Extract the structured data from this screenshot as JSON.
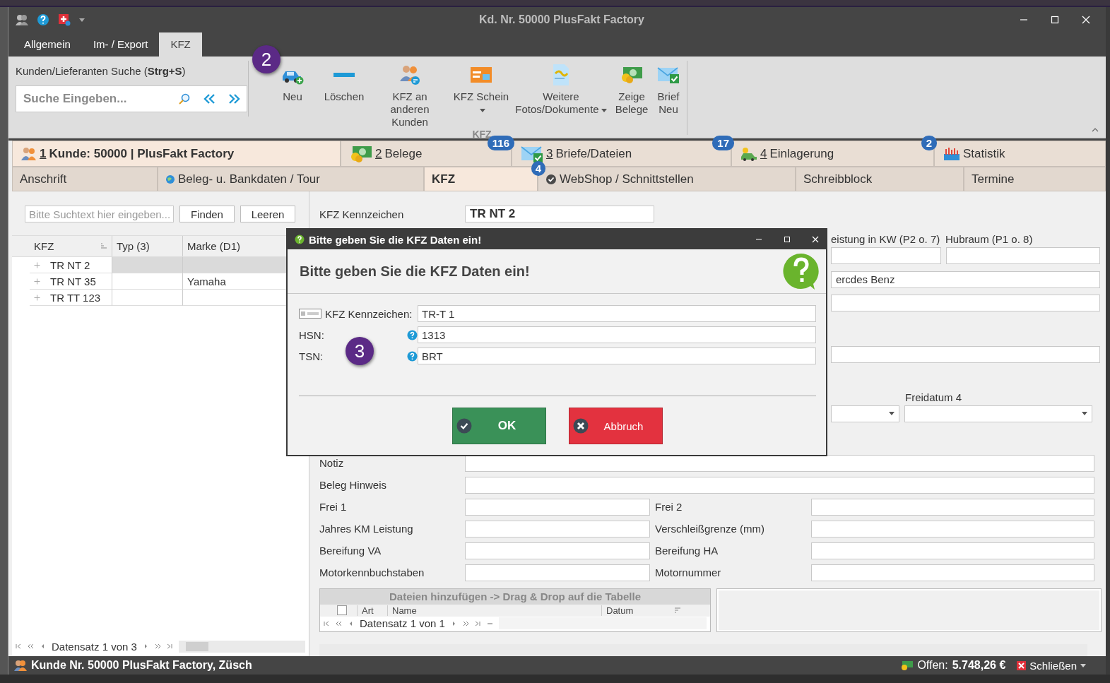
{
  "window": {
    "title": "Kd. Nr. 50000 PlusFakt Factory"
  },
  "ribbon": {
    "tabs": [
      {
        "label": "Allgemein",
        "selected": false
      },
      {
        "label": "Im- / Export",
        "selected": false
      },
      {
        "label": "KFZ",
        "selected": true
      }
    ],
    "search": {
      "label": "Kunden/Lieferanten Suche (**Strg+S**)",
      "placeholder": "Suche Eingeben..."
    },
    "step_marker": "2",
    "buttons": [
      {
        "label": "Neu",
        "kind": "car-add",
        "dropdown": false
      },
      {
        "label": "Löschen",
        "kind": "minus",
        "dropdown": false
      },
      {
        "label": "KFZ an anderen Kunden",
        "kind": "people-swap",
        "dropdown": false
      },
      {
        "label": "KFZ Schein",
        "kind": "card",
        "dropdown": true
      },
      {
        "label": "Weitere Fotos/Dokumente",
        "kind": "document",
        "dropdown": true
      },
      {
        "label": "Zeige Belege",
        "kind": "money",
        "dropdown": false
      },
      {
        "label": "Brief Neu",
        "kind": "mail",
        "dropdown": false
      }
    ],
    "group_label": "KFZ"
  },
  "main_tabs": [
    {
      "key": "1",
      "label": "Kunde: 50000 | PlusFakt Factory",
      "kind": "people",
      "selected": true
    },
    {
      "key": "2",
      "label": "Belege",
      "kind": "money",
      "badge": "116",
      "selected": false
    },
    {
      "key": "3",
      "label": "Briefe/Dateien",
      "kind": "mail",
      "badge": "17",
      "selected": false
    },
    {
      "key": "4",
      "label": "Einlagerung",
      "kind": "car",
      "badge": "2",
      "selected": false
    },
    {
      "label": "Statistik",
      "kind": "chart",
      "selected": false
    }
  ],
  "sub_tabs": [
    {
      "label": "Anschrift",
      "selected": false
    },
    {
      "label": "Beleg- u. Bankdaten / Tour",
      "kind": "globe",
      "selected": false
    },
    {
      "label": "KFZ",
      "badge": "4",
      "selected": true
    },
    {
      "label": "WebShop / Schnittstellen",
      "kind": "check",
      "selected": false
    },
    {
      "label": "Schreibblock",
      "selected": false
    },
    {
      "label": "Termine",
      "selected": false
    }
  ],
  "list_panel": {
    "search_placeholder": "Bitte Suchtext hier eingeben...",
    "find_button": "Finden",
    "clear_button": "Leeren",
    "columns": [
      "KFZ",
      "Typ (3)",
      "Marke (D1)"
    ],
    "rows": [
      {
        "cells": [
          "TR NT 2",
          "",
          ""
        ],
        "selected": true
      },
      {
        "cells": [
          "TR NT 35",
          "",
          "Yamaha"
        ],
        "selected": false
      },
      {
        "cells": [
          "TR TT 123",
          "",
          ""
        ],
        "selected": false
      }
    ],
    "navigator": "Datensatz 1 von 3"
  },
  "form": {
    "plate": {
      "label": "KFZ Kennzeichen",
      "value": "TR NT 2"
    },
    "partial_labels": [
      "eistung in KW (P2 o. 7)",
      "Hubraum (P1 o. 8)"
    ],
    "partial_brand": "ercdes Benz",
    "date_label": "Freidatum 4",
    "wide_rows": [
      "Notiz",
      "Beleg Hinweis"
    ],
    "pair_rows": [
      [
        "Frei 1",
        "Frei 2"
      ],
      [
        "Jahres KM Leistung",
        "Verschleißgrenze (mm)"
      ],
      [
        "Bereifung VA",
        "Bereifung HA"
      ],
      [
        "Motorkennbuchstaben",
        "Motornummer"
      ]
    ],
    "files": {
      "title": "Dateien hinzufügen -> Drag & Drop auf die Tabelle",
      "checked": false,
      "columns": [
        "Art",
        "Name",
        "Datum"
      ],
      "navigator": "Datensatz 1 von 1"
    }
  },
  "dialog": {
    "title": "Bitte geben Sie die KFZ Daten ein!",
    "heading": "Bitte geben Sie die KFZ Daten ein!",
    "step_marker": "3",
    "fields": [
      {
        "label": "KFZ Kennzeichen:",
        "value": "TR-T 1",
        "kind": "plate"
      },
      {
        "label": "HSN:",
        "value": "1313",
        "kind": "help"
      },
      {
        "label": "TSN:",
        "value": "BRT",
        "kind": "help"
      }
    ],
    "buttons": [
      {
        "label": "OK",
        "kind": "ok"
      },
      {
        "label": "Abbruch",
        "kind": "cancel"
      }
    ]
  },
  "status_bar": {
    "title": "Kunde Nr. 50000 PlusFakt Factory, Züsch",
    "open_label": "Offen:",
    "open_value": "5.748,26 €",
    "close_label": "Schließen"
  }
}
